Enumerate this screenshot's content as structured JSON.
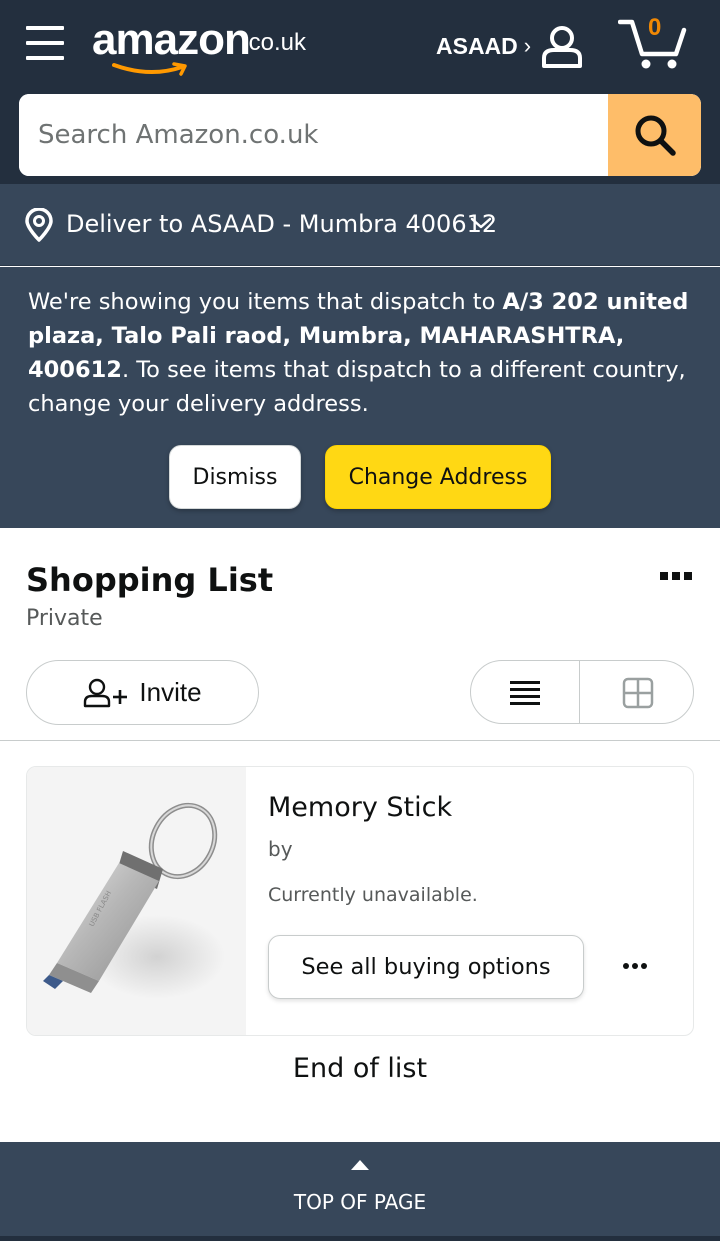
{
  "header": {
    "menu_icon": "hamburger-menu-icon",
    "logo_text": "amazon",
    "logo_tld": ".co.uk",
    "account_name": "ASAAD",
    "account_chevron": "›",
    "account_icon": "user-icon",
    "cart_count": "0",
    "cart_icon": "cart-icon",
    "colors": {
      "bg": "#232f3e",
      "search_button": "#febd69",
      "cart_count": "#f08804"
    }
  },
  "search": {
    "placeholder": "Search Amazon.co.uk",
    "value": "",
    "icon": "search-icon"
  },
  "delivery": {
    "icon": "location-pin-icon",
    "text": "Deliver to ASAAD - Mumbra 400612",
    "chevron_icon": "chevron-down-icon"
  },
  "notice": {
    "intro": "We're showing you items that dispatch to ",
    "address": "A/3 202 united plaza, Talo Pali raod, Mumbra, MAHARASHTRA, 400612",
    "outro": ". To see items that dispatch to a different country, change your delivery address.",
    "dismiss_label": "Dismiss",
    "change_label": "Change Address",
    "colors": {
      "bg": "#37475a",
      "change_button": "#ffd814"
    }
  },
  "list": {
    "title": "Shopping List",
    "privacy": "Private",
    "more_icon": "more-options-icon",
    "invite_label": "Invite",
    "invite_icon": "add-person-icon",
    "view_list_icon": "list-view-icon",
    "view_grid_icon": "grid-view-icon",
    "items": [
      {
        "title": "Memory Stick",
        "by": "by",
        "status": "Currently unavailable.",
        "image_icon": "usb-flash-drive-image",
        "image_engraving": "USB FLASH",
        "action_label": "See all buying options",
        "more_icon": "item-more-icon"
      }
    ],
    "end_label": "End of list"
  },
  "footer": {
    "top_label": "TOP OF PAGE",
    "arrow_icon": "caret-up-icon"
  }
}
